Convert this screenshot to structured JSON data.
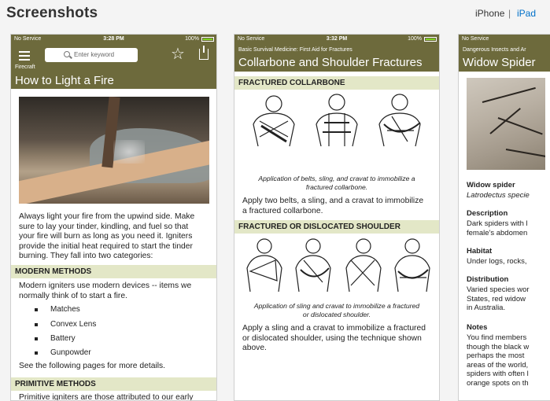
{
  "header": {
    "title": "Screenshots",
    "device_iphone": "iPhone",
    "separator": "|",
    "device_ipad": "iPad"
  },
  "screen1": {
    "status": {
      "carrier": "No Service",
      "time": "3:28 PM",
      "battery": "100%"
    },
    "search_placeholder": "Enter keyword",
    "category": "Firecraft",
    "title": "How to Light a Fire",
    "intro_lines": [
      "Always light your fire from the upwind side. Make",
      "sure to lay your tinder, kindling, and fuel so that",
      "your fire will burn as long as you need it. Igniters",
      "provide the initial heat required to start the tinder",
      "burning. They fall into two categories:"
    ],
    "section1": "MODERN METHODS",
    "modern_lines": [
      "Modern igniters use modern devices -- items we",
      "normally think of to start a fire."
    ],
    "items": [
      "Matches",
      "Convex Lens",
      "Battery",
      "Gunpowder"
    ],
    "more_text": "See the following pages for more details.",
    "section2": "PRIMITIVE METHODS",
    "cut_text": "Primitive igniters are those attributed to our early"
  },
  "screen2": {
    "status": {
      "carrier": "No Service",
      "time": "3:32 PM",
      "battery": "100%"
    },
    "category": "Basic Survival Medicine: First Aid for Fractures",
    "title": "Collarbone and Shoulder Fractures",
    "section1": "FRACTURED COLLARBONE",
    "caption1_lines": [
      "Application of belts, sling, and cravat to immobilize a",
      "fractured collarbone."
    ],
    "body1_lines": [
      "Apply two belts, a sling, and a cravat to immobilize",
      "a fractured collarbone."
    ],
    "section2": "FRACTURED OR DISLOCATED SHOULDER",
    "caption2_lines": [
      "Application of sling and cravat to immobilize a fractured",
      "or dislocated shoulder."
    ],
    "body2_lines": [
      "Apply a sling and a cravat to immobilize a fractured",
      "or dislocated shoulder, using the technique shown",
      "above."
    ]
  },
  "screen3": {
    "status": {
      "carrier": "No Service"
    },
    "category": "Dangerous Insects and Ar",
    "title": "Widow Spider",
    "name_label": "Widow spider",
    "latin": "Latrodectus specie",
    "description_label": "Description",
    "description_lines": [
      "Dark spiders with l",
      "female's abdomen"
    ],
    "habitat_label": "Habitat",
    "habitat_lines": [
      "Under logs, rocks,"
    ],
    "distribution_label": "Distribution",
    "distribution_lines": [
      "Varied species wor",
      "States, red widow",
      "in Australia."
    ],
    "notes_label": "Notes",
    "notes_lines": [
      "You find members",
      "though the black w",
      "perhaps the most",
      "areas of the world,",
      "spiders with often l",
      "orange spots on th"
    ]
  },
  "colors": {
    "olive": "#6d6a3c",
    "band": "#e3e7c7",
    "link": "#0070c9"
  }
}
